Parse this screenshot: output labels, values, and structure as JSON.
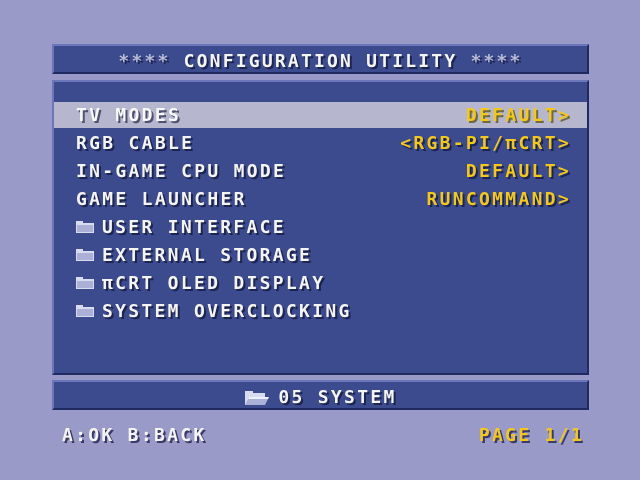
{
  "header": {
    "deco_left": "****",
    "title": "CONFIGURATION UTILITY",
    "deco_right": "****"
  },
  "menu": {
    "settings": [
      {
        "label": "TV MODES",
        "value": "DEFAULT>",
        "selected": true
      },
      {
        "label": "RGB CABLE",
        "value": "<RGB-PI/πCRT>",
        "selected": false
      },
      {
        "label": "IN-GAME CPU MODE",
        "value": "DEFAULT>",
        "selected": false
      },
      {
        "label": "GAME LAUNCHER",
        "value": "RUNCOMMAND>",
        "selected": false
      }
    ],
    "folders": [
      {
        "label": "USER INTERFACE",
        "icon": "folder-icon"
      },
      {
        "label": "EXTERNAL STORAGE",
        "icon": "folder-icon"
      },
      {
        "label": "πCRT OLED DISPLAY",
        "icon": "folder-icon"
      },
      {
        "label": "SYSTEM OVERCLOCKING",
        "icon": "folder-icon"
      }
    ]
  },
  "footer": {
    "icon": "open-folder-icon",
    "path": "05 SYSTEM"
  },
  "controls": {
    "hint": "A:OK B:BACK",
    "page": "PAGE 1/1"
  },
  "colors": {
    "background": "#9a9ac8",
    "panel": "#3c4a8e",
    "selected_row": "#b6b6ce",
    "value_text": "#f2c81e",
    "label_text": "#f4f4f4"
  }
}
